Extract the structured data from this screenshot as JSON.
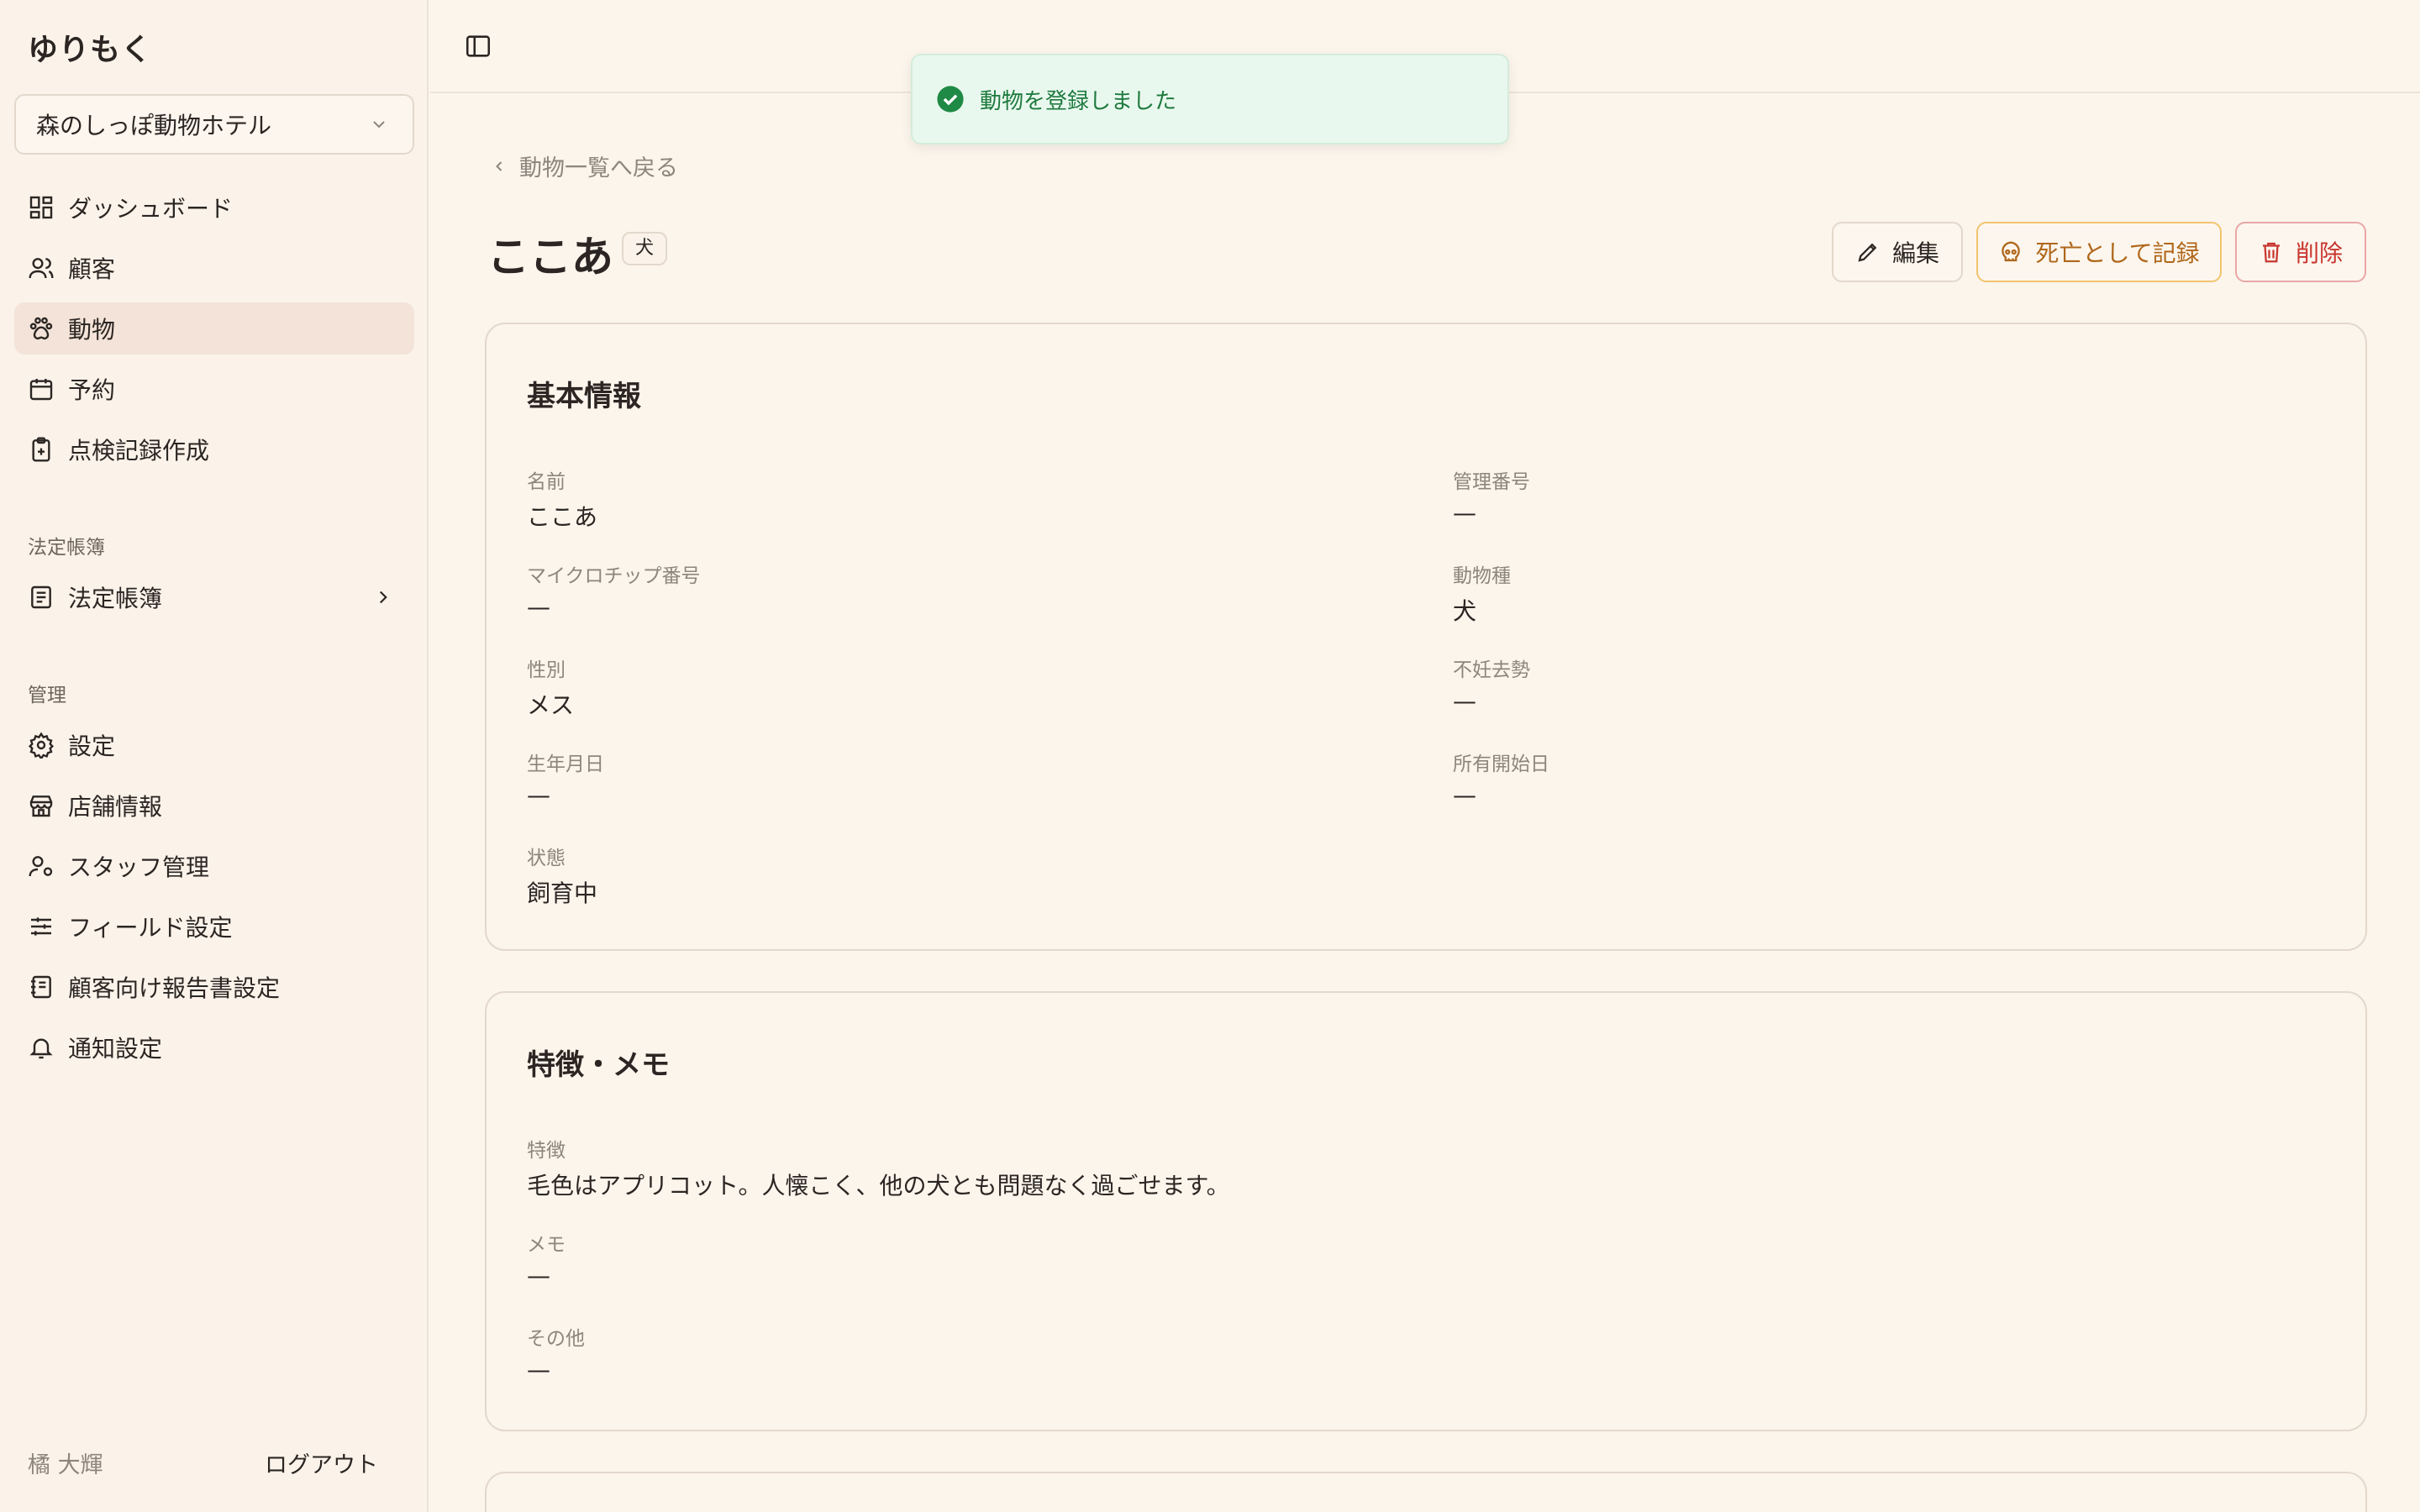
{
  "sidebar": {
    "brand": "ゆりもく",
    "store": "森のしっぽ動物ホテル",
    "nav": [
      {
        "label": "ダッシュボード"
      },
      {
        "label": "顧客"
      },
      {
        "label": "動物"
      },
      {
        "label": "予約"
      },
      {
        "label": "点検記録作成"
      }
    ],
    "section_legal": "法定帳簿",
    "legal_item": "法定帳簿",
    "section_admin": "管理",
    "admin": [
      {
        "label": "設定"
      },
      {
        "label": "店舗情報"
      },
      {
        "label": "スタッフ管理"
      },
      {
        "label": "フィールド設定"
      },
      {
        "label": "顧客向け報告書設定"
      },
      {
        "label": "通知設定"
      }
    ],
    "user_name": "橘 大輝",
    "logout": "ログアウト"
  },
  "toast": "動物を登録しました",
  "back_link": "動物一覧へ戻る",
  "page": {
    "title": "ここあ",
    "species_badge": "犬",
    "edit": "編集",
    "record_death": "死亡として記録",
    "delete": "削除"
  },
  "basic_info": {
    "title": "基本情報",
    "fields": [
      {
        "label": "名前",
        "value": "ここあ"
      },
      {
        "label": "管理番号",
        "value": "—"
      },
      {
        "label": "マイクロチップ番号",
        "value": "—"
      },
      {
        "label": "動物種",
        "value": "犬"
      },
      {
        "label": "性別",
        "value": "メス"
      },
      {
        "label": "不妊去勢",
        "value": "—"
      },
      {
        "label": "生年月日",
        "value": "—"
      },
      {
        "label": "所有開始日",
        "value": "—"
      },
      {
        "label": "状態",
        "value": "飼育中"
      }
    ]
  },
  "features": {
    "title": "特徴・メモ",
    "fields": [
      {
        "label": "特徴",
        "value": "毛色はアプリコット。人懐こく、他の犬とも問題なく過ごせます。"
      },
      {
        "label": "メモ",
        "value": "—"
      },
      {
        "label": "その他",
        "value": "—"
      }
    ]
  },
  "colors": {
    "accent_active": "#f3e3d8",
    "toast_bg": "#e9f8ee",
    "danger": "#c8362f",
    "warning": "#b0671a"
  }
}
